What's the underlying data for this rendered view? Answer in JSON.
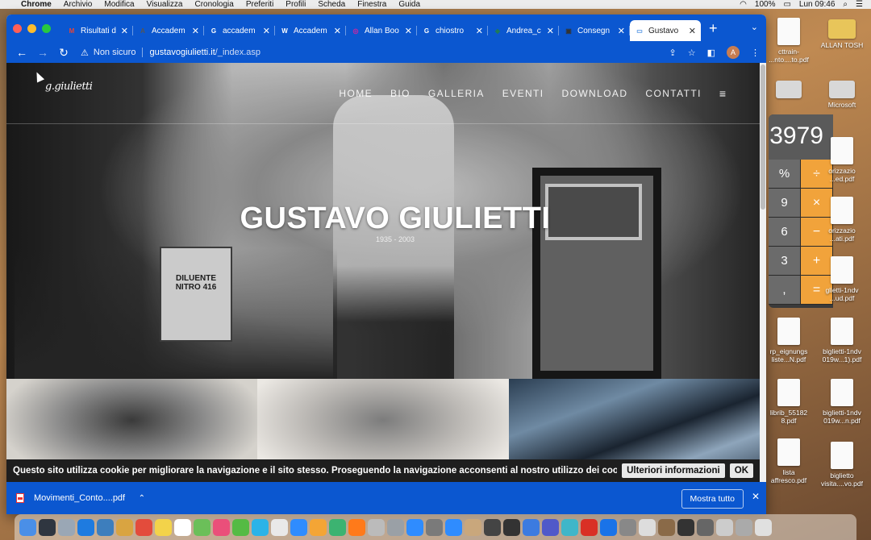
{
  "menubar": {
    "items": [
      "Chrome",
      "Archivio",
      "Modifica",
      "Visualizza",
      "Cronologia",
      "Preferiti",
      "Profili",
      "Scheda",
      "Finestra",
      "Guida"
    ],
    "battery": "100%",
    "clock": "Lun 09:46"
  },
  "tabs": [
    {
      "title": "Risultati d",
      "icon": "gmail-icon",
      "fav_text": "M",
      "fav_color": "#ea4335",
      "active": false
    },
    {
      "title": "Accadem",
      "icon": "accademia-icon",
      "fav_text": "A",
      "fav_color": "#555555",
      "active": false
    },
    {
      "title": "accadem",
      "icon": "google-icon",
      "fav_text": "G",
      "fav_color": "#ffffff",
      "active": false
    },
    {
      "title": "Accadem",
      "icon": "wikipedia-icon",
      "fav_text": "W",
      "fav_color": "#ffffff",
      "active": false
    },
    {
      "title": "Allan Boo",
      "icon": "instagram-icon",
      "fav_text": "◎",
      "fav_color": "#d6249f",
      "active": false
    },
    {
      "title": "chiostro",
      "icon": "google-icon",
      "fav_text": "G",
      "fav_color": "#ffffff",
      "active": false
    },
    {
      "title": "Andrea_c",
      "icon": "site-icon",
      "fav_text": "◆",
      "fav_color": "#1f7a5a",
      "active": false
    },
    {
      "title": "Consegn",
      "icon": "classroom-icon",
      "fav_text": "▣",
      "fav_color": "#333333",
      "active": false
    },
    {
      "title": "Gustavo",
      "icon": "page-icon",
      "fav_text": "▭",
      "fav_color": "#4a90e2",
      "active": true
    }
  ],
  "toolbar": {
    "security_label": "Non sicuro",
    "url_host": "gustavogiulietti.it",
    "url_path": "/_index.asp",
    "profile_initial": "A"
  },
  "site": {
    "logo_text": "g.giulietti",
    "nav": [
      "HOME",
      "BIO",
      "GALLERIA",
      "EVENTI",
      "DOWNLOAD",
      "CONTATTI"
    ],
    "hero_title": "GUSTAVO GIULIETTI",
    "hero_dates": "1935  -  2003",
    "can_label": "DILUENTE NITRO 416"
  },
  "cookie": {
    "message": "Questo sito utilizza cookie per migliorare la navigazione e il sito stesso. Proseguendo la navigazione acconsenti al nostro utilizzo dei cookie.",
    "more_label": "Ulteriori informazioni",
    "ok_label": "OK"
  },
  "downloads": {
    "file_name": "Movimenti_Conto....pdf",
    "show_all_label": "Mostra tutto"
  },
  "calculator": {
    "display": "3979",
    "keys": [
      [
        "%",
        "÷"
      ],
      [
        "9",
        "×"
      ],
      [
        "6",
        "−"
      ],
      [
        "3",
        "+"
      ],
      [
        ",",
        "="
      ]
    ]
  },
  "desktop": [
    {
      "label": "cttrain-\n...nto....to.pdf",
      "kind": "doc"
    },
    {
      "label": "ALLAN TOSH",
      "kind": "folder"
    },
    {
      "label": "",
      "kind": "drive"
    },
    {
      "label": "Microsoft",
      "kind": "drive"
    },
    {
      "label": "orizzazio\n...ed.pdf",
      "kind": "doc"
    },
    {
      "label": "orizzazio\n...ati.pdf",
      "kind": "doc"
    },
    {
      "label": "glietti-1ndv\n...ud.pdf",
      "kind": "doc"
    },
    {
      "label": "rp_eignungs\nliste...N.pdf",
      "kind": "doc"
    },
    {
      "label": "biglietti-1ndv\n019w...1).pdf",
      "kind": "doc"
    },
    {
      "label": "librib_55182\n8.pdf",
      "kind": "doc"
    },
    {
      "label": "biglietti-1ndv\n019w...n.pdf",
      "kind": "doc"
    },
    {
      "label": "lista\naffresco.pdf",
      "kind": "doc"
    },
    {
      "label": "biglietto\nvisita....vo.pdf",
      "kind": "doc"
    }
  ],
  "dock_colors": [
    "#4a8fe7",
    "#2f3640",
    "#9aa7b5",
    "#1e7be0",
    "#3d7ebd",
    "#d9a441",
    "#e34c3c",
    "#f3d34a",
    "#ffffff",
    "#6bbf59",
    "#ea4f7a",
    "#55bb44",
    "#2bb3e8",
    "#e9e9e9",
    "#2f8cff",
    "#f4a535",
    "#3cb371",
    "#ff7a1a",
    "#bbbbbb",
    "#9aa0a6",
    "#2f8cff",
    "#7a7a7a",
    "#2f8cff",
    "#c9a77c",
    "#444444",
    "#333333",
    "#3c7be0",
    "#5059c9",
    "#3fb6c9",
    "#d93025",
    "#1a73e8",
    "#888888",
    "#dddddd",
    "#8a6a48",
    "#333333",
    "#666666",
    "#cccccc",
    "#aaaaaa",
    "#e0e0e0"
  ]
}
